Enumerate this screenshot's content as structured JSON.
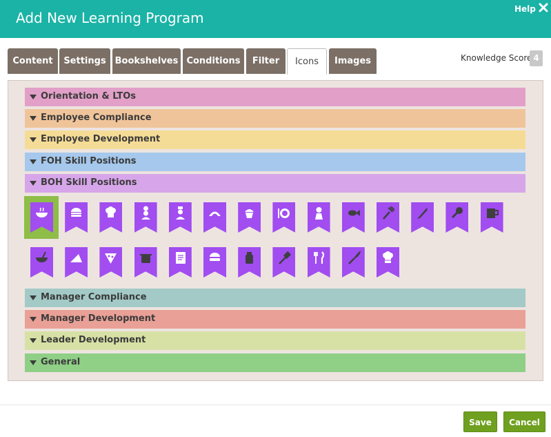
{
  "dialog": {
    "title": "Add New Learning Program",
    "help_label": "Help"
  },
  "tabs": [
    {
      "label": "Content"
    },
    {
      "label": "Settings"
    },
    {
      "label": "Bookshelves"
    },
    {
      "label": "Conditions"
    },
    {
      "label": "Filter"
    },
    {
      "label": "Icons",
      "active": true
    },
    {
      "label": "Images"
    }
  ],
  "knowledge_score": {
    "label": "Knowledge Score",
    "value": "4"
  },
  "categories": [
    {
      "label": "Orientation & LTOs",
      "color": "#e2a0c8"
    },
    {
      "label": "Employee Compliance",
      "color": "#f0c49a"
    },
    {
      "label": "Employee Development",
      "color": "#f5dc96"
    },
    {
      "label": "FOH Skill Positions",
      "color": "#a6c8ec"
    },
    {
      "label": "BOH Skill Positions",
      "color": "#d7a6ea"
    },
    {
      "label": "Manager Compliance",
      "color": "#a3cac6"
    },
    {
      "label": "Manager Development",
      "color": "#e9a096"
    },
    {
      "label": "Leader Development",
      "color": "#d7e1a5"
    },
    {
      "label": "General",
      "color": "#8fcf86"
    }
  ],
  "icons": {
    "ribbon_color": "#a14df0",
    "selected_color": "#8ebd48",
    "items": [
      {
        "name": "soup-bowl-icon",
        "selected": true
      },
      {
        "name": "burger-icon"
      },
      {
        "name": "chef-hat-icon"
      },
      {
        "name": "chef-icon"
      },
      {
        "name": "cook-icon"
      },
      {
        "name": "croissant-icon"
      },
      {
        "name": "cupcake-icon"
      },
      {
        "name": "plate-setting-icon"
      },
      {
        "name": "waitress-icon"
      },
      {
        "name": "fish-icon"
      },
      {
        "name": "fork-icon"
      },
      {
        "name": "knife-icon"
      },
      {
        "name": "chicken-leg-icon"
      },
      {
        "name": "mug-icon"
      },
      {
        "name": "mixing-bowl-icon"
      },
      {
        "name": "pie-slice-icon"
      },
      {
        "name": "pizza-slice-icon"
      },
      {
        "name": "pot-icon"
      },
      {
        "name": "recipe-book-icon"
      },
      {
        "name": "sandwich-icon"
      },
      {
        "name": "spice-jar-icon"
      },
      {
        "name": "spatula-icon"
      },
      {
        "name": "utensils-icon"
      },
      {
        "name": "whisk-icon"
      },
      {
        "name": "toque-icon"
      }
    ]
  },
  "footer": {
    "save_label": "Save",
    "cancel_label": "Cancel"
  },
  "colors": {
    "header": "#1ab3a6",
    "tab": "#7b6f66",
    "button": "#6fa01f",
    "panel": "#ede4e0"
  }
}
